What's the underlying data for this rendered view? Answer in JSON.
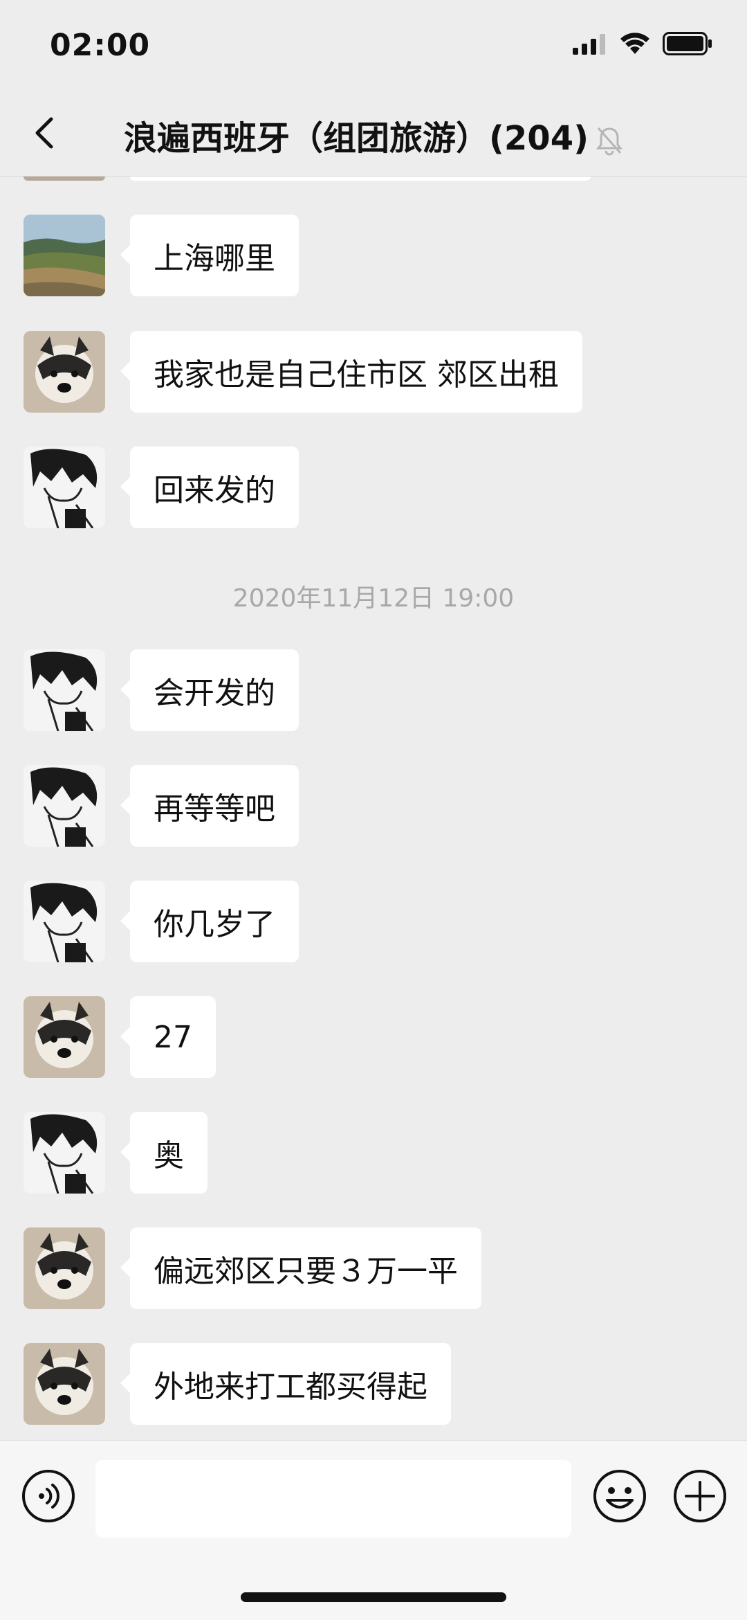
{
  "status": {
    "time": "02:00"
  },
  "nav": {
    "title": "浪遍西班牙（组团旅游）(204)"
  },
  "messages": [
    {
      "avatar": "landscape",
      "text": "上海哪里"
    },
    {
      "avatar": "husky",
      "text": "我家也是自己住市区 郊区出租"
    },
    {
      "avatar": "manga",
      "text": "回来发的"
    },
    {
      "avatar": "manga",
      "text": "会开发的"
    },
    {
      "avatar": "manga",
      "text": "再等等吧"
    },
    {
      "avatar": "manga",
      "text": "你几岁了"
    },
    {
      "avatar": "husky",
      "text": "27"
    },
    {
      "avatar": "manga",
      "text": "奥"
    },
    {
      "avatar": "husky",
      "text": "偏远郊区只要３万一平"
    },
    {
      "avatar": "husky",
      "text": "外地来打工都买得起"
    }
  ],
  "timestamp": "2020年11月12日 19:00",
  "input": {
    "value": ""
  },
  "colors": {
    "background": "#ededed",
    "bubble": "#ffffff",
    "timestamp": "#a8a8a8"
  }
}
